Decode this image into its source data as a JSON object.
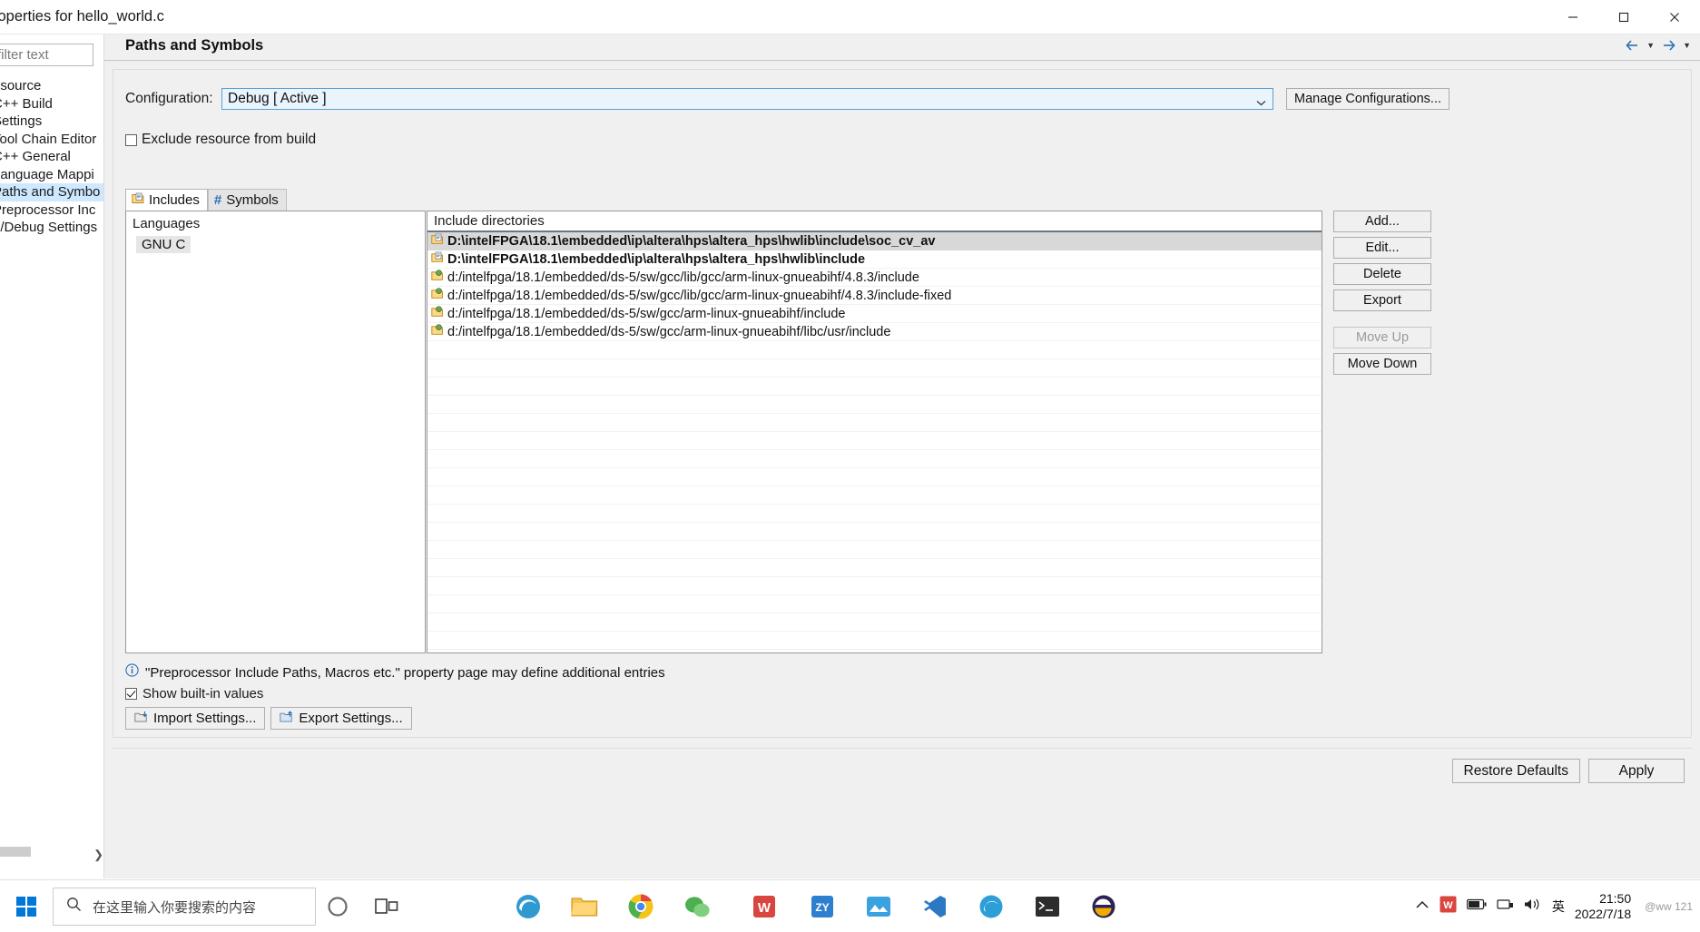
{
  "window": {
    "title": "roperties for hello_world.c",
    "minimize_label": "Minimize",
    "maximize_label": "Maximize",
    "close_label": "Close"
  },
  "sidebar": {
    "filter_placeholder": "filter text",
    "items": [
      {
        "label": "esource",
        "selected": false
      },
      {
        "label": "C++ Build",
        "selected": false
      },
      {
        "label": "Settings",
        "selected": false
      },
      {
        "label": "Tool Chain Editor",
        "selected": false
      },
      {
        "label": "C++ General",
        "selected": false
      },
      {
        "label": "Language Mappi",
        "selected": false
      },
      {
        "label": "Paths and Symbo",
        "selected": true
      },
      {
        "label": "Preprocessor Inc",
        "selected": false
      },
      {
        "label": "n/Debug Settings",
        "selected": false
      }
    ]
  },
  "page": {
    "title": "Paths and Symbols",
    "configuration_label": "Configuration:",
    "configuration_value": "Debug  [ Active ]",
    "manage_configurations_label": "Manage Configurations...",
    "exclude_label": "Exclude resource from build",
    "exclude_checked": false
  },
  "tabs": [
    {
      "label": "Includes",
      "icon": "includes-folder-icon",
      "active": true
    },
    {
      "label": "Symbols",
      "icon": "hash-icon",
      "active": false
    }
  ],
  "languages": {
    "header": "Languages",
    "items": [
      "GNU C"
    ]
  },
  "include_directories": {
    "header": "Include directories",
    "rows": [
      {
        "path": "D:\\intelFPGA\\18.1\\embedded\\ip\\altera\\hps\\altera_hps\\hwlib\\include\\soc_cv_av",
        "bold": true,
        "selected": true,
        "icon": "folder-include-icon"
      },
      {
        "path": "D:\\intelFPGA\\18.1\\embedded\\ip\\altera\\hps\\altera_hps\\hwlib\\include",
        "bold": true,
        "selected": false,
        "icon": "folder-include-icon"
      },
      {
        "path": "d:/intelfpga/18.1/embedded/ds-5/sw/gcc/lib/gcc/arm-linux-gnueabihf/4.8.3/include",
        "bold": false,
        "selected": false,
        "icon": "folder-builtin-icon"
      },
      {
        "path": "d:/intelfpga/18.1/embedded/ds-5/sw/gcc/lib/gcc/arm-linux-gnueabihf/4.8.3/include-fixed",
        "bold": false,
        "selected": false,
        "icon": "folder-builtin-icon"
      },
      {
        "path": "d:/intelfpga/18.1/embedded/ds-5/sw/gcc/arm-linux-gnueabihf/include",
        "bold": false,
        "selected": false,
        "icon": "folder-builtin-icon"
      },
      {
        "path": "d:/intelfpga/18.1/embedded/ds-5/sw/gcc/arm-linux-gnueabihf/libc/usr/include",
        "bold": false,
        "selected": false,
        "icon": "folder-builtin-icon"
      }
    ]
  },
  "side_buttons": [
    {
      "label": "Add...",
      "enabled": true
    },
    {
      "label": "Edit...",
      "enabled": true
    },
    {
      "label": "Delete",
      "enabled": true
    },
    {
      "label": "Export",
      "enabled": true
    },
    {
      "label": "Move Up",
      "enabled": false
    },
    {
      "label": "Move Down",
      "enabled": true
    }
  ],
  "bottom": {
    "info_text": "\"Preprocessor Include Paths, Macros etc.\" property page may define additional entries",
    "show_builtin_label": "Show built-in values",
    "show_builtin_checked": true,
    "import_settings_label": "Import Settings...",
    "export_settings_label": "Export Settings..."
  },
  "footer": {
    "restore_defaults_label": "Restore Defaults",
    "apply_label": "Apply"
  },
  "taskbar": {
    "search_placeholder": "在这里输入你要搜索的内容",
    "ime_label": "英",
    "clock_time": "21:50",
    "clock_date": "2022/7/18",
    "watermark": "@ww  121"
  }
}
